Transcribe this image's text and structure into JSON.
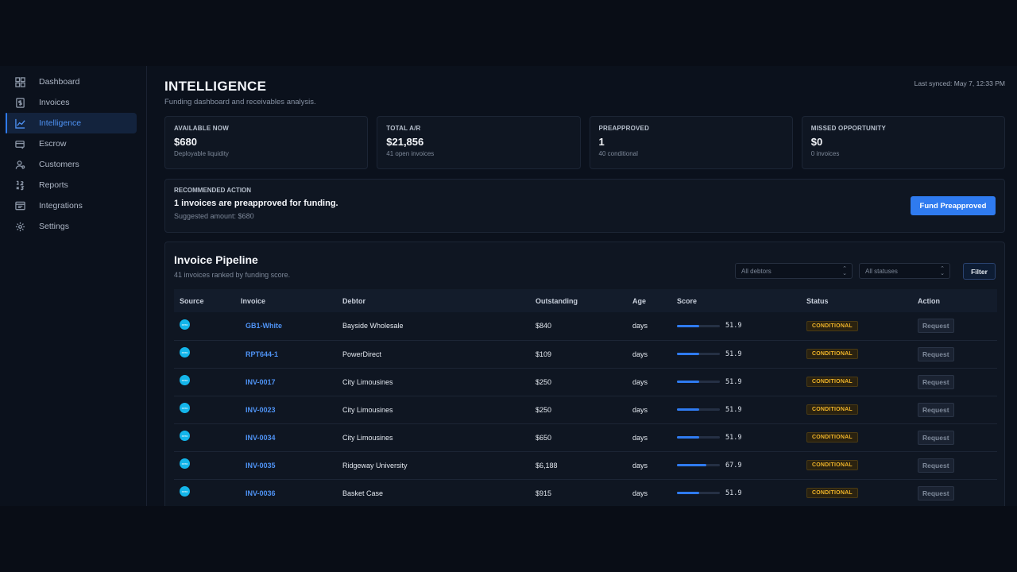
{
  "sidebar": {
    "items": [
      {
        "label": "Dashboard",
        "icon": "grid-icon",
        "active": false
      },
      {
        "label": "Invoices",
        "icon": "dollar-doc-icon",
        "active": false
      },
      {
        "label": "Intelligence",
        "icon": "chart-icon",
        "active": true
      },
      {
        "label": "Escrow",
        "icon": "escrow-icon",
        "active": false
      },
      {
        "label": "Customers",
        "icon": "users-icon",
        "active": false
      },
      {
        "label": "Reports",
        "icon": "reports-icon",
        "active": false
      },
      {
        "label": "Integrations",
        "icon": "integrations-icon",
        "active": false
      },
      {
        "label": "Settings",
        "icon": "gear-icon",
        "active": false
      }
    ]
  },
  "header": {
    "title": "INTELLIGENCE",
    "subtitle": "Funding dashboard and receivables analysis.",
    "last_synced": "Last synced: May 7, 12:33 PM"
  },
  "stats": [
    {
      "label": "AVAILABLE NOW",
      "value": "$680",
      "sub": "Deployable liquidity"
    },
    {
      "label": "TOTAL A/R",
      "value": "$21,856",
      "sub": "41 open invoices"
    },
    {
      "label": "PREAPPROVED",
      "value": "1",
      "sub": "40 conditional"
    },
    {
      "label": "MISSED OPPORTUNITY",
      "value": "$0",
      "sub": "0 invoices"
    }
  ],
  "recommendation": {
    "label": "RECOMMENDED ACTION",
    "title": "1 invoices are preapproved for funding.",
    "sub": "Suggested amount: $680",
    "button": "Fund Preapproved"
  },
  "pipeline": {
    "title": "Invoice Pipeline",
    "subtitle": "41 invoices ranked by funding score.",
    "debtor_select": "All debtors",
    "status_select": "All statuses",
    "filter_button": "Filter",
    "columns": [
      "Source",
      "Invoice",
      "Debtor",
      "Outstanding",
      "Age",
      "Score",
      "Status",
      "Action"
    ],
    "source_icon_text": "xero",
    "rows": [
      {
        "invoice": "GB1-White",
        "debtor": "Bayside Wholesale",
        "outstanding": "$840",
        "age": "days",
        "score": "51.9",
        "status": "CONDITIONAL",
        "action": "Request"
      },
      {
        "invoice": "RPT644-1",
        "debtor": "PowerDirect",
        "outstanding": "$109",
        "age": "days",
        "score": "51.9",
        "status": "CONDITIONAL",
        "action": "Request"
      },
      {
        "invoice": "INV-0017",
        "debtor": "City Limousines",
        "outstanding": "$250",
        "age": "days",
        "score": "51.9",
        "status": "CONDITIONAL",
        "action": "Request"
      },
      {
        "invoice": "INV-0023",
        "debtor": "City Limousines",
        "outstanding": "$250",
        "age": "days",
        "score": "51.9",
        "status": "CONDITIONAL",
        "action": "Request"
      },
      {
        "invoice": "INV-0034",
        "debtor": "City Limousines",
        "outstanding": "$650",
        "age": "days",
        "score": "51.9",
        "status": "CONDITIONAL",
        "action": "Request"
      },
      {
        "invoice": "INV-0035",
        "debtor": "Ridgeway University",
        "outstanding": "$6,188",
        "age": "days",
        "score": "67.9",
        "status": "CONDITIONAL",
        "action": "Request"
      },
      {
        "invoice": "INV-0036",
        "debtor": "Basket Case",
        "outstanding": "$915",
        "age": "days",
        "score": "51.9",
        "status": "CONDITIONAL",
        "action": "Request"
      }
    ]
  },
  "colors": {
    "accent": "#2f7bf0",
    "status_conditional": "#f0b429",
    "source_brand": "#13b5ea"
  }
}
